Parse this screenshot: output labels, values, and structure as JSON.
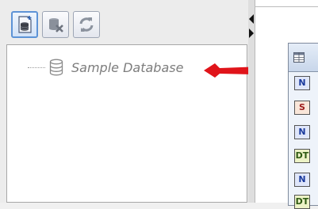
{
  "toolbar": {
    "buttons": [
      {
        "icon": "add-database-icon",
        "active": true
      },
      {
        "icon": "remove-database-icon",
        "active": false
      },
      {
        "icon": "refresh-icon",
        "active": false
      }
    ]
  },
  "tree": {
    "items": [
      {
        "label": "Sample Database",
        "icon": "database-icon"
      }
    ]
  },
  "annotation": {
    "arrow_color": "#e0141a"
  },
  "table": {
    "header_icon": "table-grid-icon",
    "field_types": [
      {
        "code": "N",
        "color": "#1a3a9c",
        "bg": "#dfe6fa"
      },
      {
        "code": "S",
        "color": "#9c1a1a",
        "bg": "#f9e6d9"
      },
      {
        "code": "N",
        "color": "#1a3a9c",
        "bg": "#dfe6fa"
      },
      {
        "code": "DT",
        "color": "#2e5a12",
        "bg": "#ecf2c6"
      },
      {
        "code": "N",
        "color": "#1a3a9c",
        "bg": "#dfe6fa"
      },
      {
        "code": "DT",
        "color": "#2e5a12",
        "bg": "#ecf2c6"
      }
    ]
  }
}
